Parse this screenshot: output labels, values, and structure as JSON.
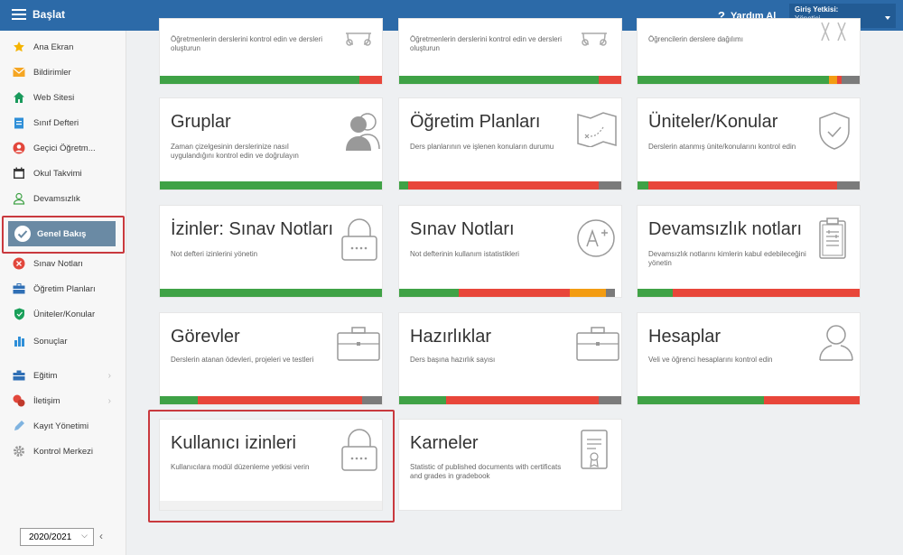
{
  "header": {
    "menu_label": "Başlat",
    "help_label": "Yardım Al",
    "help_symbol": "?",
    "login_title": "Giriş Yetkisi:",
    "login_role": "Yönetici"
  },
  "sidebar": {
    "items": [
      {
        "label": "Ana Ekran",
        "icon": "star-icon"
      },
      {
        "label": "Bildirimler",
        "icon": "mail-icon"
      },
      {
        "label": "Web Sitesi",
        "icon": "home-icon"
      },
      {
        "label": "Sınıf Defteri",
        "icon": "notebook-icon"
      },
      {
        "label": "Geçici Öğretm...",
        "icon": "user-circle-icon"
      },
      {
        "label": "Okul Takvimi",
        "icon": "calendar-icon"
      },
      {
        "label": "Devamsızlık",
        "icon": "person-outline-icon"
      },
      {
        "label": "Genel Bakış",
        "icon": "check-circle-icon"
      },
      {
        "label": "Sınav Notları",
        "icon": "grade-icon"
      },
      {
        "label": "Öğretim Planları",
        "icon": "briefcase-icon"
      },
      {
        "label": "Üniteler/Konular",
        "icon": "shield-icon"
      },
      {
        "label": "Sonuçlar",
        "icon": "bar-chart-icon"
      },
      {
        "label": "Eğitim",
        "icon": "education-icon"
      },
      {
        "label": "İletişim",
        "icon": "chat-icon"
      },
      {
        "label": "Kayıt Yönetimi",
        "icon": "pen-icon"
      },
      {
        "label": "Kontrol Merkezi",
        "icon": "gear-icon"
      }
    ],
    "year": "2020/2021",
    "collapse_symbol": "‹"
  },
  "cards": {
    "row0": [
      {
        "desc": "Öğretmenlerin derslerini kontrol edin ve dersleri oluşturun"
      },
      {
        "desc": "Öğretmenlerin derslerini kontrol edin ve dersleri oluşturun"
      },
      {
        "desc": "Öğrencilerin derslere dağılımı"
      }
    ],
    "gruplar": {
      "title": "Gruplar",
      "desc": "Zaman çizelgesinin derslerinize nasıl uygulandığını kontrol edin ve doğrulayın"
    },
    "ogretim_planlari": {
      "title": "Öğretim Planları",
      "desc": "Ders planlarının ve işlenen konuların durumu"
    },
    "uniteler": {
      "title": "Üniteler/Konular",
      "desc": "Derslerin atanmış ünite/konularını kontrol edin"
    },
    "izinler": {
      "title": "İzinler: Sınav Notları",
      "desc": "Not defteri izinlerini yönetin"
    },
    "sinav_notlari": {
      "title": "Sınav Notları",
      "desc": "Not defterinin kullanım istatistikleri"
    },
    "devamsizlik": {
      "title": "Devamsızlık notları",
      "desc": "Devamsızlık notlarını kimlerin kabul edebileceğini yönetin"
    },
    "gorevler": {
      "title": "Görevler",
      "desc": "Derslerin atanan ödevleri, projeleri ve testleri"
    },
    "hazirliklar": {
      "title": "Hazırlıklar",
      "desc": "Ders başına hazırlık sayısı"
    },
    "hesaplar": {
      "title": "Hesaplar",
      "desc": "Veli ve öğrenci hesaplarını kontrol edin"
    },
    "kullanici": {
      "title": "Kullanıcı izinleri",
      "desc": "Kullanıcılara modül düzenleme yetkisi verin"
    },
    "karneler": {
      "title": "Karneler",
      "desc": "Statistic of published documents with certificats and grades in gradebook"
    }
  },
  "colors": {
    "green": "#3fa246",
    "red": "#e8463a",
    "orange": "#f39c12",
    "gray": "#7b7b7b",
    "accent": "#2c6aa8",
    "highlight": "#c9393e"
  }
}
